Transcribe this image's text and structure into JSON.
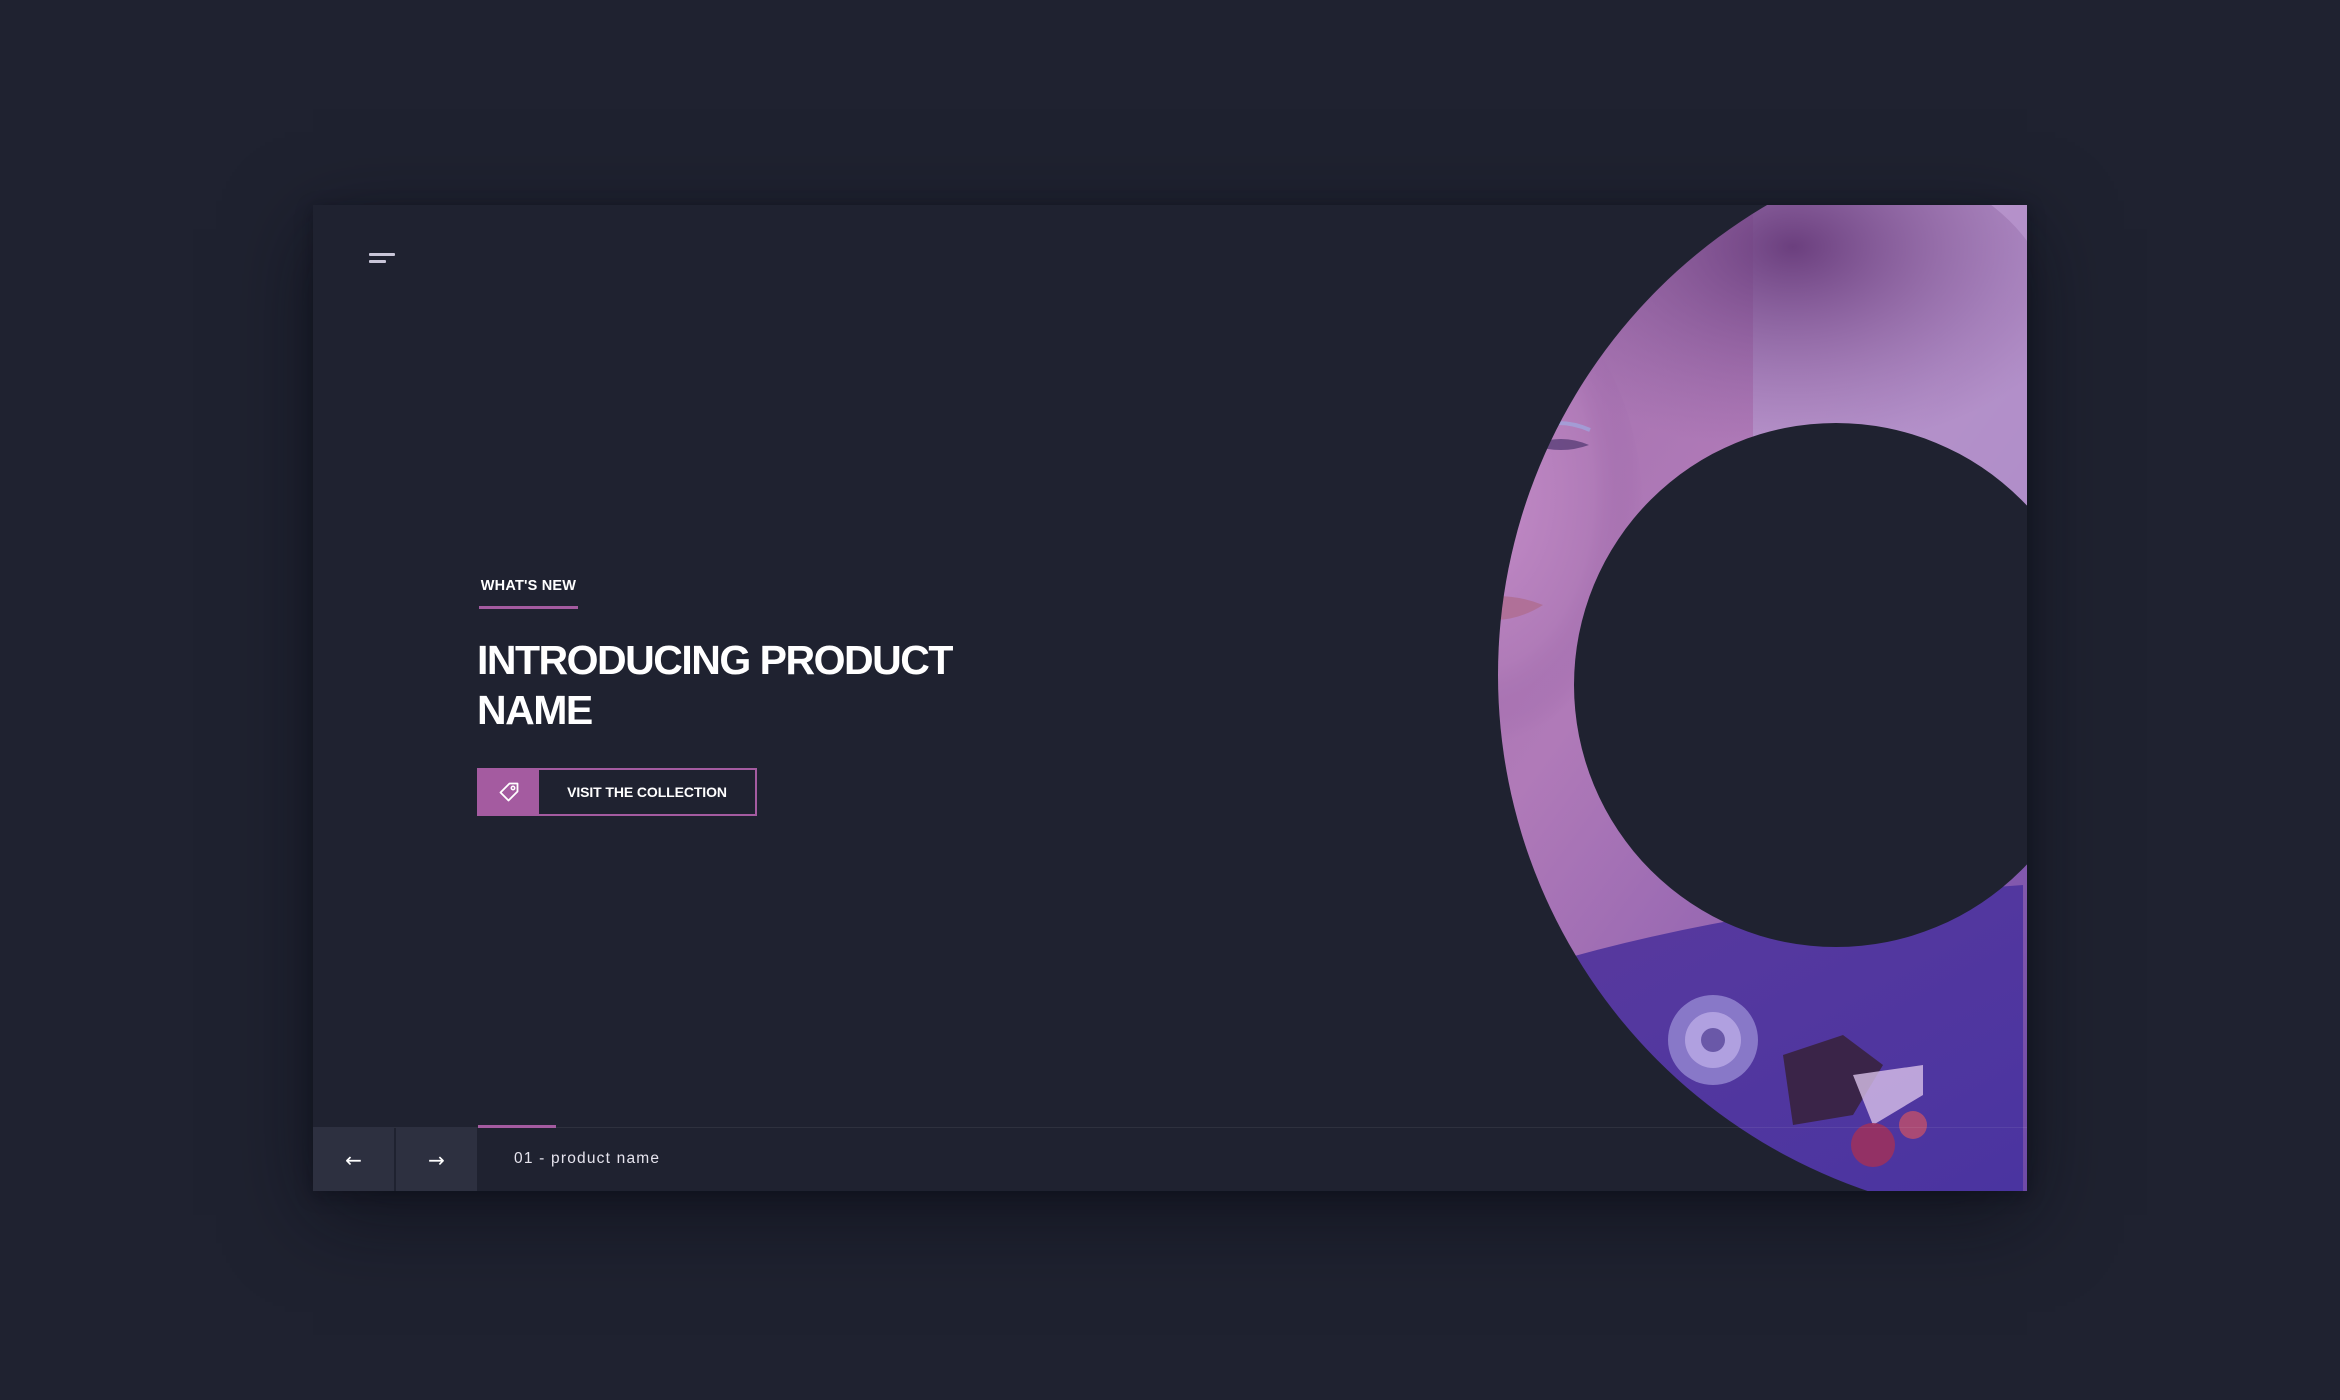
{
  "header": {
    "menu_icon": "hamburger-menu-icon"
  },
  "hero": {
    "eyebrow": "WHAT'S NEW",
    "headline_line1": "INTRODUCING PRODUCT",
    "headline_line2": "NAME",
    "cta_icon": "price-tag-icon",
    "cta_label": "VISIT THE COLLECTION",
    "image_description_name": "hero-portrait-image"
  },
  "slider": {
    "prev_icon": "arrow-left-icon",
    "next_icon": "arrow-right-icon",
    "prev_glyph": "←",
    "next_glyph": "→",
    "current_label": "01 - product name",
    "progress": 0.2
  },
  "colors": {
    "background": "#1f2230",
    "accent": "#a45ba0",
    "nav_button": "#2d3040",
    "text": "#ffffff"
  }
}
